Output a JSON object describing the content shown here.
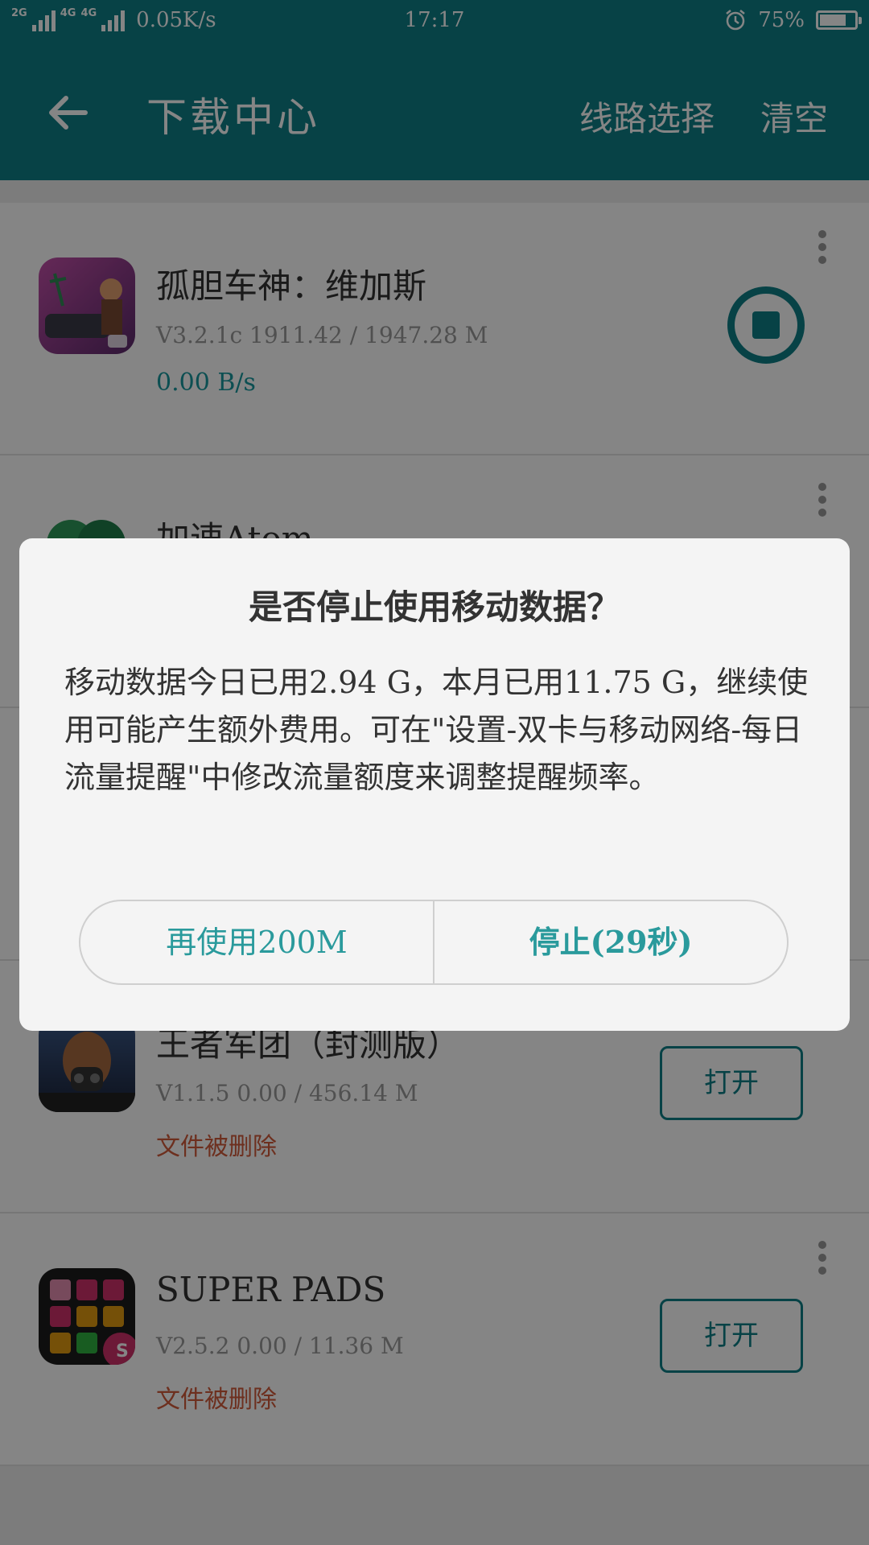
{
  "status_bar": {
    "net_left": "2G",
    "net_mid": "4G",
    "net_mid2": "4G",
    "speed": "0.05K/s",
    "time": "17:17",
    "battery": "75%",
    "battery_level": 0.75
  },
  "appbar": {
    "title": "下载中心",
    "route_label": "线路选择",
    "clear_label": "清空"
  },
  "items": [
    {
      "name": "孤胆车神：维加斯",
      "meta": "V3.2.1c  1911.42 / 1947.28 M",
      "status": "0.00 B/s"
    },
    {
      "name": "加速Atom"
    },
    {
      "name": "王者军团（封测版）",
      "meta": "V1.1.5  0.00 / 456.14 M",
      "status": "文件被删除",
      "button": "打开"
    },
    {
      "name": "SUPER PADS",
      "meta": "V2.5.2  0.00 / 11.36 M",
      "status": "文件被删除",
      "button": "打开"
    }
  ],
  "dialog": {
    "title": "是否停止使用移动数据？",
    "message": "移动数据今日已用2.94 G，本月已用11.75 G，继续使用可能产生额外费用。可在\"设置-双卡与移动网络-每日流量提醒\"中修改流量额度来调整提醒频率。",
    "btn_more": "再使用200M",
    "btn_stop": "停止(29秒)"
  },
  "colors": {
    "accent": "#0e7f87",
    "dialog_button_text": "#2a9a9c",
    "deleted_text": "#d25a3a"
  }
}
